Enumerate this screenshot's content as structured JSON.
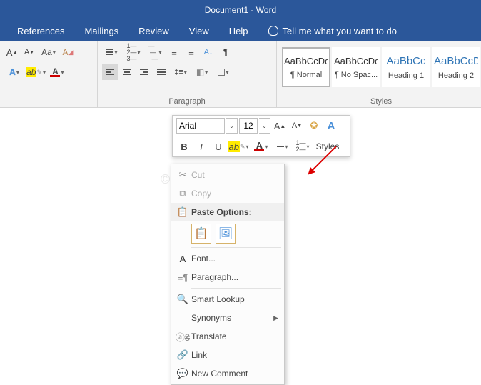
{
  "title": "Document1  -  Word",
  "menu": [
    "References",
    "Mailings",
    "Review",
    "View",
    "Help"
  ],
  "tellme": "Tell me what you want to do",
  "groups": {
    "paragraph": "Paragraph",
    "styles": "Styles"
  },
  "styles": [
    {
      "preview": "AaBbCcDd",
      "name": "¶ Normal",
      "selected": true,
      "blue": false
    },
    {
      "preview": "AaBbCcDd",
      "name": "¶ No Spac...",
      "selected": false,
      "blue": false
    },
    {
      "preview": "AaBbCc",
      "name": "Heading 1",
      "selected": false,
      "blue": true
    },
    {
      "preview": "AaBbCcD",
      "name": "Heading 2",
      "selected": false,
      "blue": true
    }
  ],
  "mini": {
    "font": "Arial",
    "size": "12",
    "styles_label": "Styles",
    "bold": "B",
    "italic": "I",
    "underline": "U"
  },
  "context": {
    "cut": "Cut",
    "copy": "Copy",
    "paste_header": "Paste Options:",
    "font": "Font...",
    "paragraph": "Paragraph...",
    "smart": "Smart Lookup",
    "synonyms": "Synonyms",
    "translate": "Translate",
    "link": "Link",
    "comment": "New Comment"
  },
  "watermark": "©TheGeekPage.com"
}
